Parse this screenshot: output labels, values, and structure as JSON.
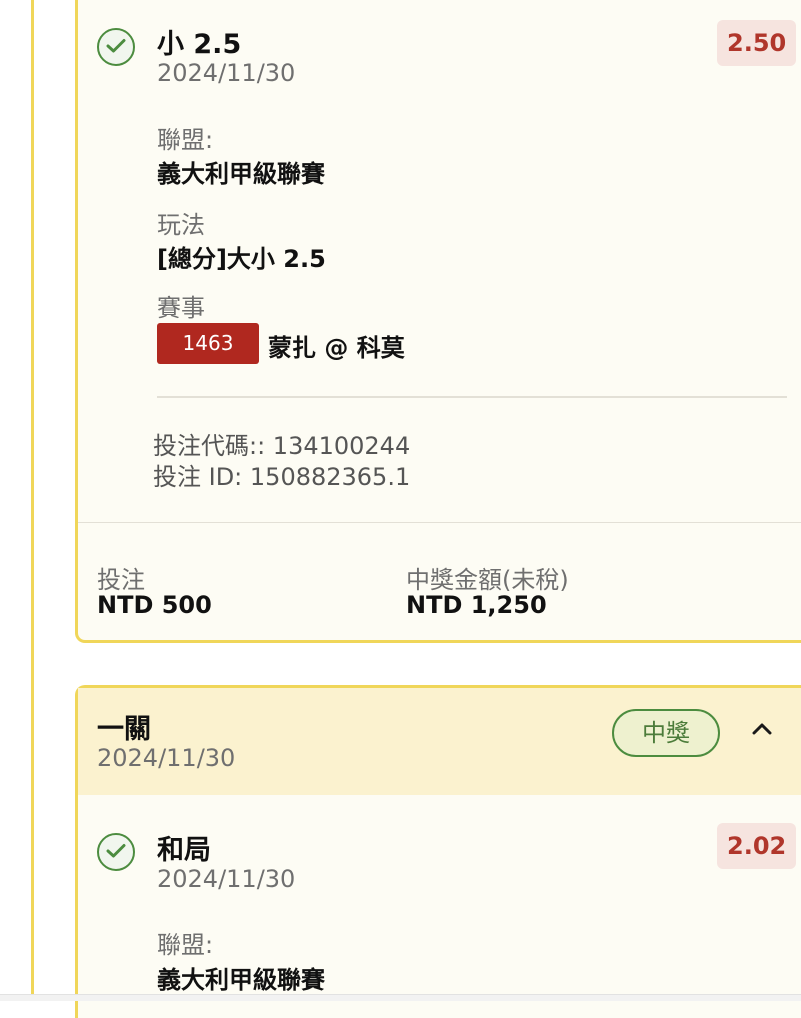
{
  "bet1": {
    "selection": "小 2.5",
    "date": "2024/11/30",
    "odds": "2.50",
    "league_label": "聯盟:",
    "league": "義大利甲級聯賽",
    "market_label": "玩法",
    "market": "[總分]大小 2.5",
    "event_label": "賽事",
    "event_number": "1463",
    "event_name": "蒙扎 @ 科莫",
    "bet_code": "投注代碼:: 134100244",
    "bet_id": "投注 ID: 150882365.1",
    "stake_label": "投注",
    "stake": "NTD 500",
    "payout_label": "中獎金額(未稅)",
    "payout": "NTD 1,250"
  },
  "ticket2": {
    "type": "一關",
    "date": "2024/11/30",
    "status": "中獎",
    "selection": "和局",
    "selection_date": "2024/11/30",
    "odds": "2.02",
    "league_label": "聯盟:",
    "league": "義大利甲級聯賽"
  },
  "colors": {
    "accent_yellow": "#f0d659",
    "win_green": "#4c8c3f",
    "odds_red": "#b0362b",
    "event_badge": "#b0281f"
  },
  "icons": {
    "selection_status": "check-circle-icon",
    "collapse": "chevron-up-icon"
  }
}
